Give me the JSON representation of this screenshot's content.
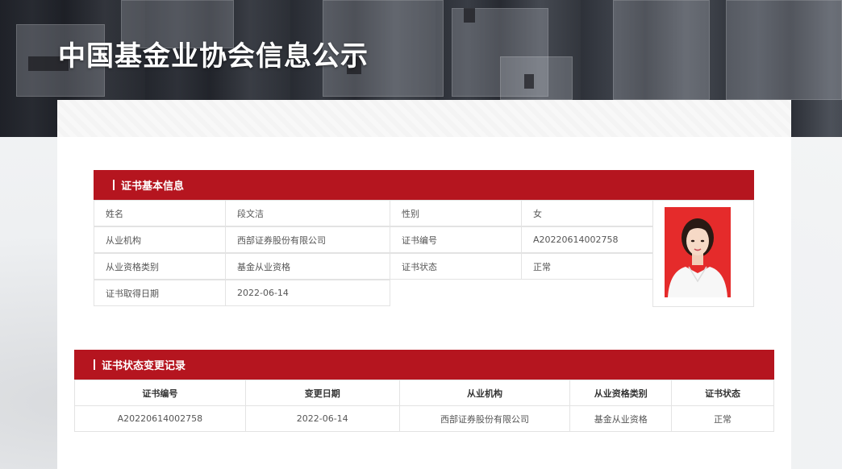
{
  "site": {
    "title": "中国基金业协会信息公示"
  },
  "basic_info": {
    "header": "证书基本信息",
    "rows": [
      {
        "label1": "姓名",
        "value1": "段文洁",
        "label2": "性别",
        "value2": "女"
      },
      {
        "label1": "从业机构",
        "value1": "西部证券股份有限公司",
        "label2": "证书编号",
        "value2": "A20220614002758"
      },
      {
        "label1": "从业资格类别",
        "value1": "基金从业资格",
        "label2": "证书状态",
        "value2": "正常"
      },
      {
        "label1": "证书取得日期",
        "value1": "2022-06-14"
      }
    ]
  },
  "history": {
    "header": "证书状态变更记录",
    "columns": [
      "证书编号",
      "变更日期",
      "从业机构",
      "从业资格类别",
      "证书状态"
    ],
    "rows": [
      [
        "A20220614002758",
        "2022-06-14",
        "西部证券股份有限公司",
        "基金从业资格",
        "正常"
      ]
    ]
  },
  "colors": {
    "accent": "#b5151f",
    "photo_bg": "#e52b2b"
  }
}
